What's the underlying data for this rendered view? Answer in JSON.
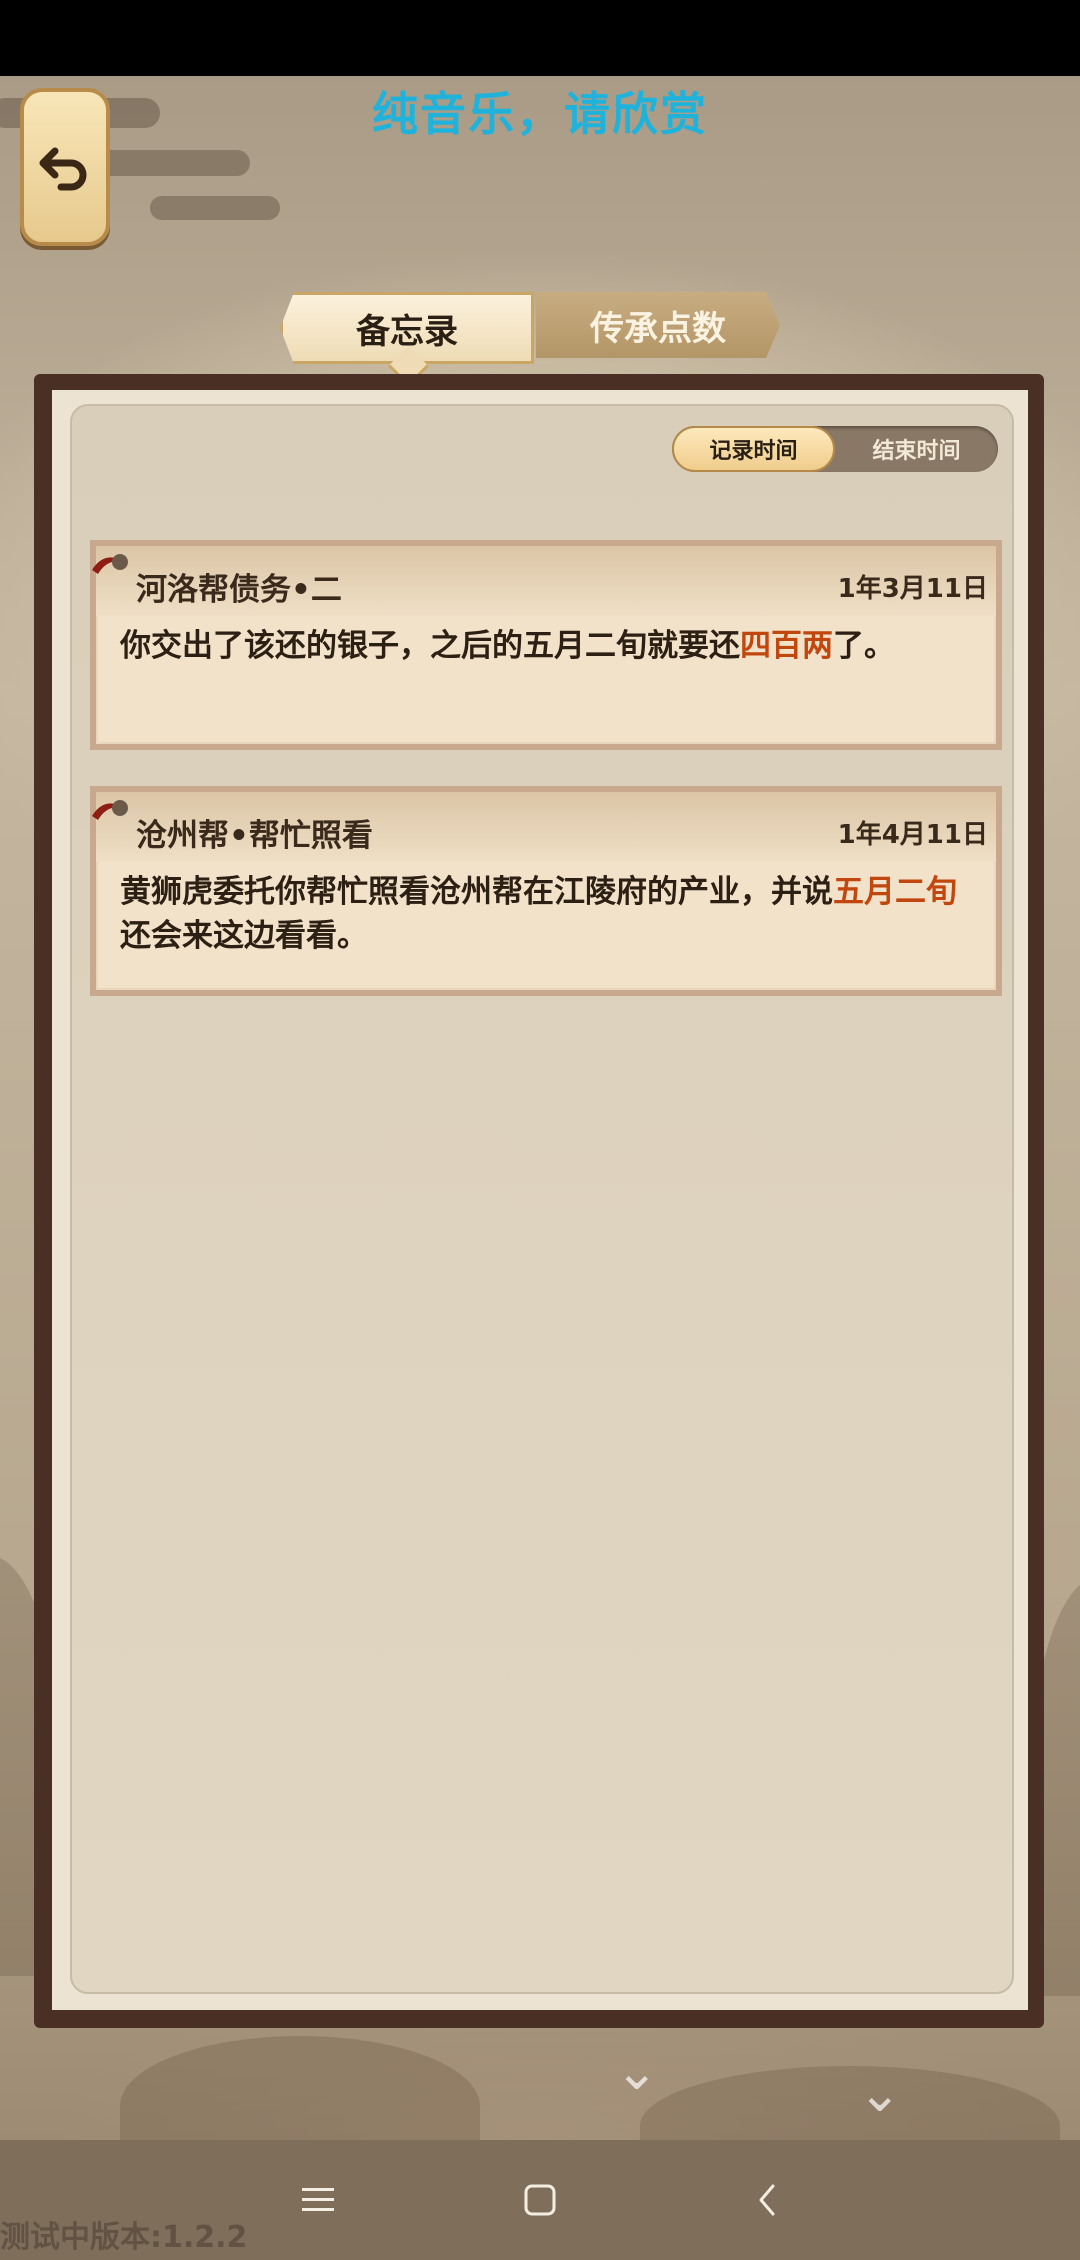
{
  "banner": {
    "title": "纯音乐，请欣赏"
  },
  "tabs": [
    {
      "label": "备忘录",
      "active": true
    },
    {
      "label": "传承点数",
      "active": false
    }
  ],
  "sort": {
    "options": [
      "记录时间",
      "结束时间"
    ],
    "selected": "记录时间"
  },
  "memos": [
    {
      "title": "河洛帮债务•二",
      "date": "1年3月11日",
      "body_before": "你交出了该还的银子，之后的五月二旬就要还",
      "body_highlight": "四百两",
      "body_after": "了。"
    },
    {
      "title": "沧州帮•帮忙照看",
      "date": "1年4月11日",
      "body_before": "黄狮虎委托你帮忙照看沧州帮在江陵府的产业，并说",
      "body_highlight": "五月二旬",
      "body_after": "还会来这边看看。"
    }
  ],
  "footer": {
    "version": "测试中版本:1.2.2"
  },
  "colors": {
    "banner": "#1fb3dc",
    "highlight": "#c1470f",
    "frame": "#4a2f24"
  },
  "icons": {
    "back": "undo-arrow-icon",
    "nav_menu": "menu-icon",
    "nav_home": "home-square-icon",
    "nav_back": "chevron-left-icon"
  }
}
